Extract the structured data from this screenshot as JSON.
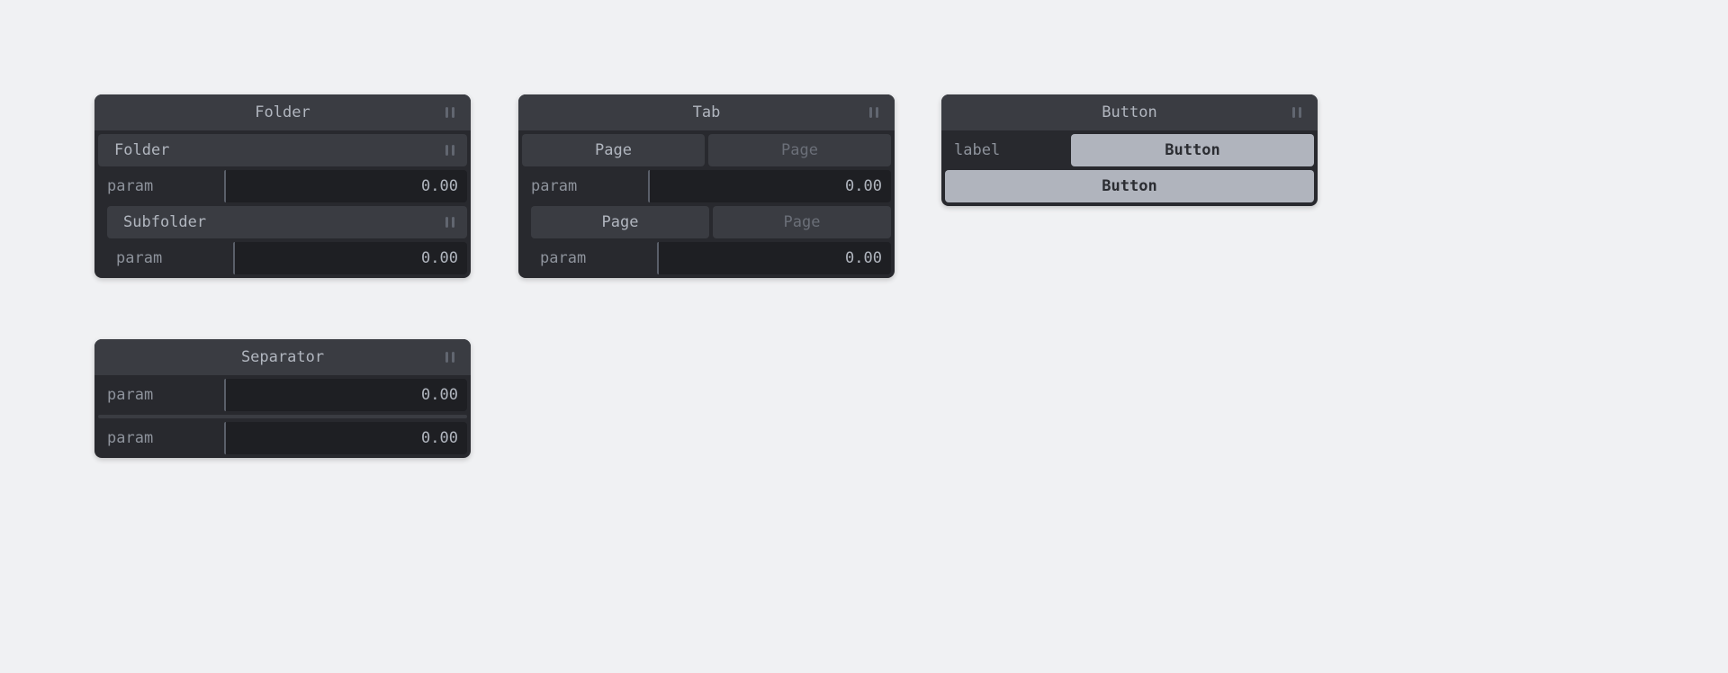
{
  "panes": {
    "folder": {
      "title": "Folder",
      "subfolder_title": "Folder",
      "subsubfolder_title": "Subfolder",
      "param_label": "param",
      "param_value": "0.00",
      "subparam_label": "param",
      "subparam_value": "0.00"
    },
    "tab": {
      "title": "Tab",
      "page1_active": "Page",
      "page1_inactive": "Page",
      "param1_label": "param",
      "param1_value": "0.00",
      "page2_active": "Page",
      "page2_inactive": "Page",
      "param2_label": "param",
      "param2_value": "0.00"
    },
    "button": {
      "title": "Button",
      "label": "label",
      "button1": "Button",
      "button2": "Button"
    },
    "separator": {
      "title": "Separator",
      "param1_label": "param",
      "param1_value": "0.00",
      "param2_label": "param",
      "param2_value": "0.00"
    }
  }
}
